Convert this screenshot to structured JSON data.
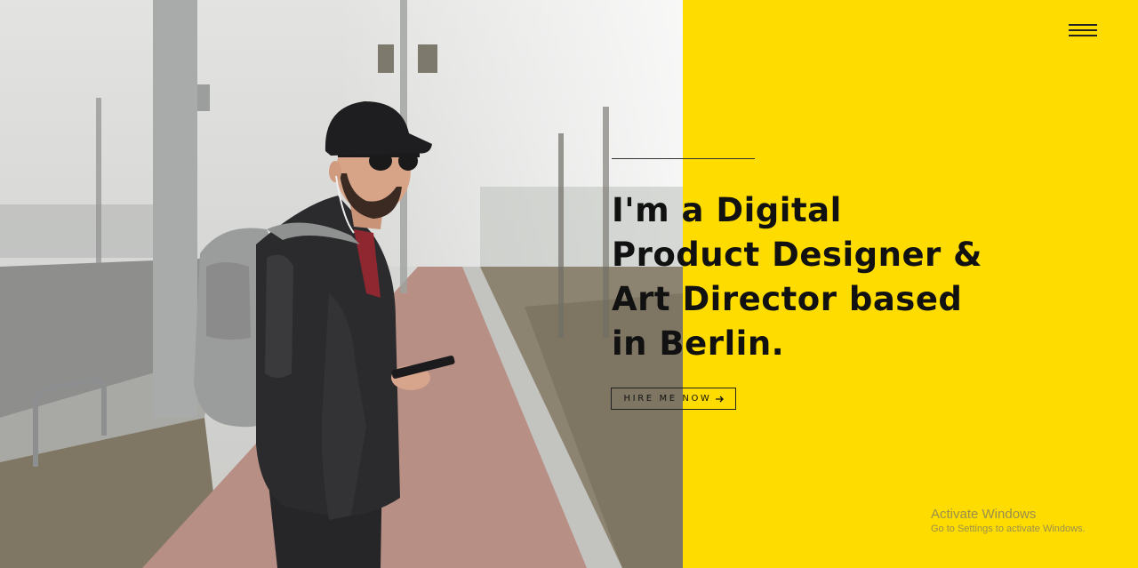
{
  "colors": {
    "accent_yellow": "#ffdc00",
    "text_dark": "#111111"
  },
  "headline": {
    "lines": [
      "I'm a Digital",
      "Product Designer &",
      "Art Director based",
      "in Berlin."
    ]
  },
  "cta": {
    "label": "HIRE ME NOW",
    "icon": "arrow-right-icon"
  },
  "menu": {
    "icon": "hamburger-menu-icon"
  },
  "photo": {
    "subject": "man-with-backpack-and-phone"
  },
  "os_watermark": {
    "title": "Activate Windows",
    "subtitle": "Go to Settings to activate Windows."
  }
}
